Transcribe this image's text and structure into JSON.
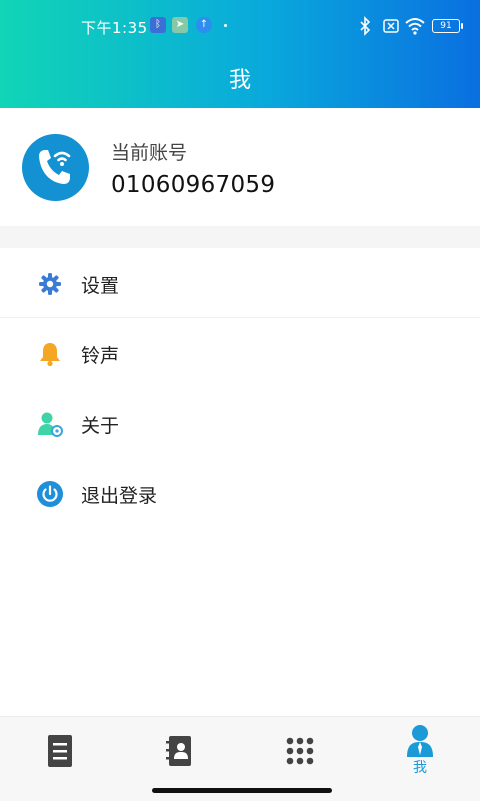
{
  "status_bar": {
    "time": "下午1:35",
    "battery": "91"
  },
  "header": {
    "title": "我"
  },
  "account": {
    "label": "当前账号",
    "number": "01060967059"
  },
  "menu": {
    "items": [
      {
        "label": "设置",
        "icon": "gear-icon"
      },
      {
        "label": "铃声",
        "icon": "bell-icon"
      },
      {
        "label": "关于",
        "icon": "user-info-icon"
      },
      {
        "label": "退出登录",
        "icon": "power-icon"
      }
    ]
  },
  "tabbar": {
    "active_label": "我"
  },
  "colors": {
    "accent": "#1a9ad6",
    "gradient_start": "#11d5b6",
    "gradient_end": "#0a6fe0"
  }
}
